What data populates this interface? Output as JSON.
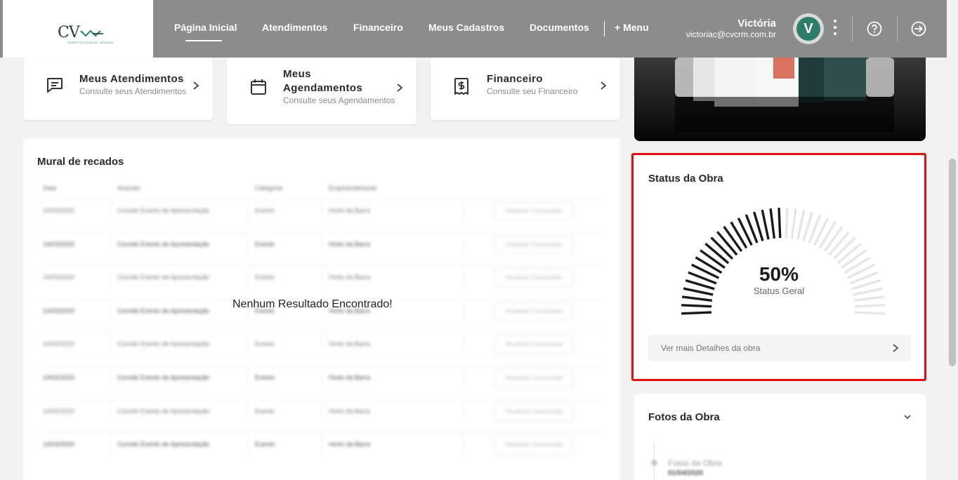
{
  "header": {
    "logo_text": "CV",
    "logo_subtext": "CONSTRUTORA DE VENDAS",
    "nav": [
      {
        "label": "Página Inicial",
        "active": true
      },
      {
        "label": "Atendimentos"
      },
      {
        "label": "Financeiro"
      },
      {
        "label": "Meus Cadastros"
      },
      {
        "label": "Documentos"
      },
      {
        "label": "+ Menu"
      }
    ],
    "user": {
      "name": "Victória",
      "email": "victoriac@cvcrm.com.br",
      "avatar_initial": "V"
    },
    "icons": [
      "kebab-menu-icon",
      "help-circle-icon",
      "logout-icon"
    ]
  },
  "quick_cards": [
    {
      "title": "Meus Atendimentos",
      "subtitle": "Consulte seus Atendimentos",
      "icon": "message-icon"
    },
    {
      "title": "Meus Agendamentos",
      "subtitle": "Consulte seus Agendamentos",
      "icon": "calendar-icon"
    },
    {
      "title": "Financeiro",
      "subtitle": "Consulte seu Financeiro",
      "icon": "finance-icon"
    }
  ],
  "mural": {
    "title": "Mural de recados",
    "columns": [
      "Data",
      "Assunto",
      "Categoria",
      "Empreendimento"
    ],
    "placeholder_row": {
      "date": "14/03/2020",
      "subject": "Convite Evento de Apresentação",
      "category": "Evento",
      "development": "Horto da Barra",
      "action": "Visualizar Comunicado"
    },
    "empty_message": "Nenhum Resultado Encontrado!"
  },
  "status_obra": {
    "title": "Status da Obra",
    "progress_percent": 50,
    "progress_label": "50%",
    "sub_label": "Status Geral",
    "details_label": "Ver mais Detalhes da obra",
    "active_color": "#1a1a1a",
    "inactive_color": "#e6e6e6"
  },
  "fotos_obra": {
    "title": "Fotos da Obra",
    "item_label": "Fotos da Obra",
    "item_date": "01/04/2020"
  }
}
